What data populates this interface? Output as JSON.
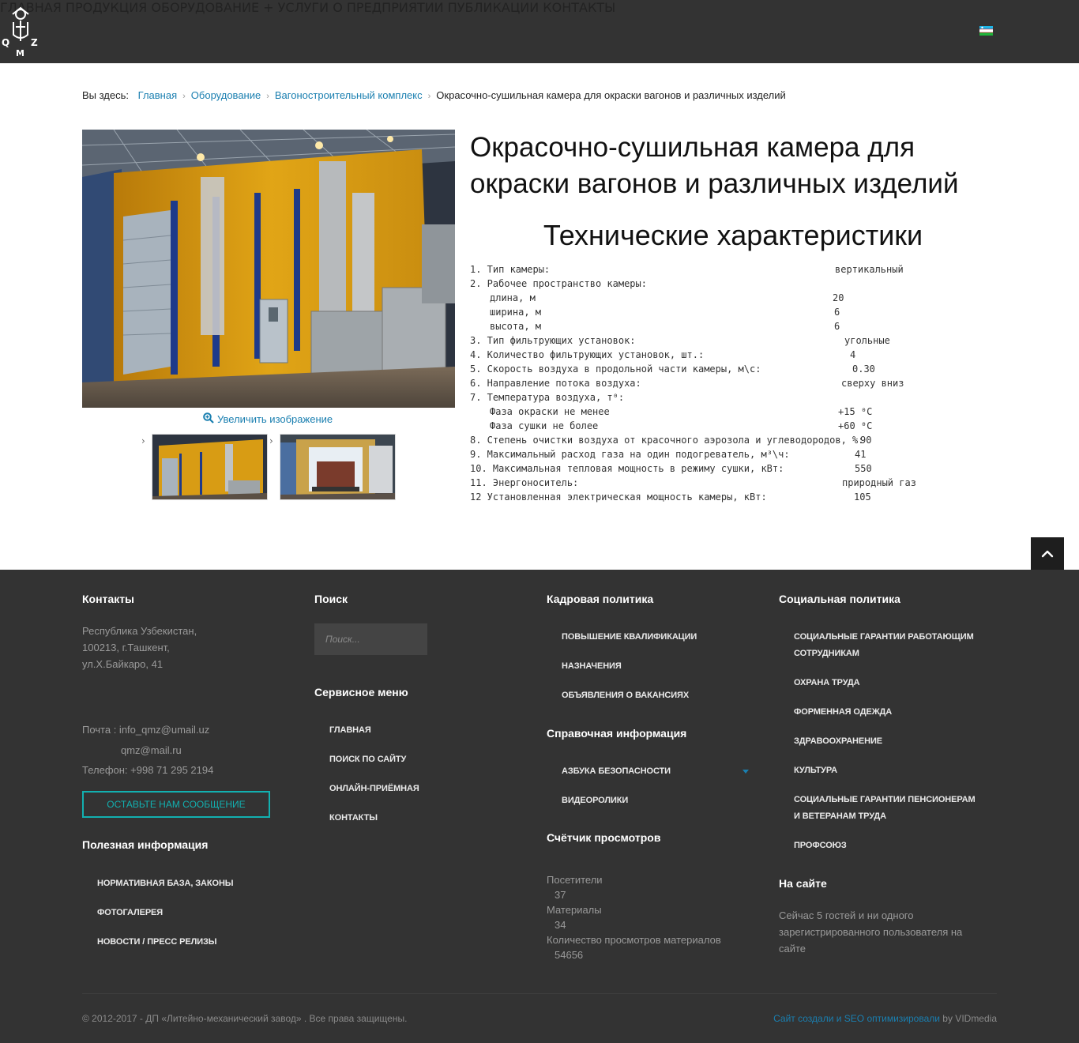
{
  "header": {
    "logo_letters": [
      "Q",
      "Z",
      "M"
    ],
    "nav": [
      {
        "label": "ГЛАВНАЯ"
      },
      {
        "label": "ПРОДУКЦИЯ"
      },
      {
        "label": "ОБОРУДОВАНИЕ +"
      },
      {
        "label": "УСЛУГИ"
      },
      {
        "label": "О ПРЕДПРИЯТИИ"
      },
      {
        "label": "ПУБЛИКАЦИИ"
      },
      {
        "label": "КОНТАКТЫ"
      }
    ],
    "language_icon": "uzbekistan-flag-icon"
  },
  "breadcrumb": {
    "prefix": "Вы здесь:",
    "items": [
      "Главная",
      "Оборудование",
      "Вагоностроительный комплекс"
    ],
    "current": "Окрасочно-сушильная камера для окраски вагонов и различных изделий",
    "separator": "›"
  },
  "gallery": {
    "enlarge_label": "Увеличить изображение",
    "thumb_arrow": "›"
  },
  "product": {
    "title": "Окрасочно-сушильная камера для окраски вагонов и различных изделий",
    "specs_title": "Технические характеристики",
    "specs": [
      {
        "label": "1. Тип камеры:",
        "value": "вертикальный"
      },
      {
        "label": "2. Рабочее пространство камеры:",
        "value": ""
      },
      {
        "label": "длина, м",
        "value": "20"
      },
      {
        "label": "ширина, м",
        "value": "6"
      },
      {
        "label": "высота, м",
        "value": "6"
      },
      {
        "label": "3. Тип фильтрующих установок:",
        "value": "угольные"
      },
      {
        "label": "4. Количество фильтрующих установок, шт.:",
        "value": "4"
      },
      {
        "label": "5. Скорость воздуха в продольной части камеры, м\\с:",
        "value": "0.30"
      },
      {
        "label": "6. Направление потока воздуха:",
        "value": "сверху вниз"
      },
      {
        "label": "7. Температура воздуха, т⁰:",
        "value": ""
      },
      {
        "label": "Фаза окраски не менее",
        "value": "+15 ⁰С"
      },
      {
        "label": "Фаза сушки не более",
        "value": "+60 ⁰С"
      },
      {
        "label": "8. Степень очистки воздуха от красочного аэрозола и углеводородов, %:",
        "value": "90"
      },
      {
        "label": "9.  Максимальный расход газа на один подогреватель, м³\\ч:",
        "value": "41"
      },
      {
        "label": "10. Максимальная  тепловая мощность в режиму сушки, кВт:",
        "value": "550"
      },
      {
        "label": "11. Энергоноситель:",
        "value": "природный газ"
      },
      {
        "label": "12 Установленная электрическая мощность камеры, кВт:",
        "value": "105"
      }
    ]
  },
  "footer": {
    "contacts": {
      "heading": "Контакты",
      "address": [
        "Республика Узбекистан,",
        "100213, г.Ташкент,",
        "ул.Х.Байкаро, 41"
      ],
      "email_line1": "Почта : info_qmz@umail.uz",
      "email_line2": "qmz@mail.ru",
      "phone": "Телефон: +998 71 295 2194",
      "message_button": "ОСТАВЬТЕ НАМ СООБЩЕНИЕ"
    },
    "useful": {
      "heading": "Полезная информация",
      "items": [
        "НОРМАТИВНАЯ БАЗА, ЗАКОНЫ",
        "ФОТОГАЛЕРЕЯ",
        "НОВОСТИ / ПРЕСС РЕЛИЗЫ"
      ]
    },
    "search": {
      "heading": "Поиск",
      "placeholder": "Поиск..."
    },
    "service": {
      "heading": "Сервисное меню",
      "items": [
        "ГЛАВНАЯ",
        "ПОИСК ПО САЙТУ",
        "ОНЛАЙН-ПРИЁМНАЯ",
        "КОНТАКТЫ"
      ]
    },
    "hr": {
      "heading": "Кадровая политика",
      "items": [
        "ПОВЫШЕНИЕ КВАЛИФИКАЦИИ",
        "НАЗНАЧЕНИЯ",
        "ОБЪЯВЛЕНИЯ О ВАКАНСИЯХ"
      ]
    },
    "reference": {
      "heading": "Справочная информация",
      "items": [
        "АЗБУКА БЕЗОПАСНОСТИ",
        "ВИДЕОРОЛИКИ"
      ]
    },
    "counter": {
      "heading": "Счётчик просмотров",
      "visitors_label": "Посетители",
      "visitors": "37",
      "materials_label": "Материалы",
      "materials": "34",
      "views_label": "Количество просмотров материалов",
      "views": "54656"
    },
    "social": {
      "heading": "Социальная политика",
      "items": [
        "СОЦИАЛЬНЫЕ ГАРАНТИИ РАБОТАЮЩИМ СОТРУДНИКАМ",
        "ОХРАНА ТРУДА",
        "ФОРМЕННАЯ ОДЕЖДА",
        "ЗДРАВООХРАНЕНИЕ",
        "КУЛЬТУРА",
        "СОЦИАЛЬНЫЕ ГАРАНТИИ ПЕНСИОНЕРАМ И ВЕТЕРАНАМ ТРУДА",
        "ПРОФСОЮЗ"
      ]
    },
    "online": {
      "heading": "На сайте",
      "lines": [
        "Сейчас 5 гостей и ни одного",
        "зарегистрированного пользователя на",
        "сайте"
      ]
    },
    "copyright": "© 2012-2017 - ДП «Литейно-механический завод» . Все права защищены.",
    "credit_link": "Сайт создали и SEO оптимизировали",
    "credit_by": " by VIDmedia"
  },
  "colors": {
    "header_bg": "#333333",
    "footer_bg": "#333333",
    "link": "#1a7fb0",
    "accent_teal": "#12b0b0"
  }
}
